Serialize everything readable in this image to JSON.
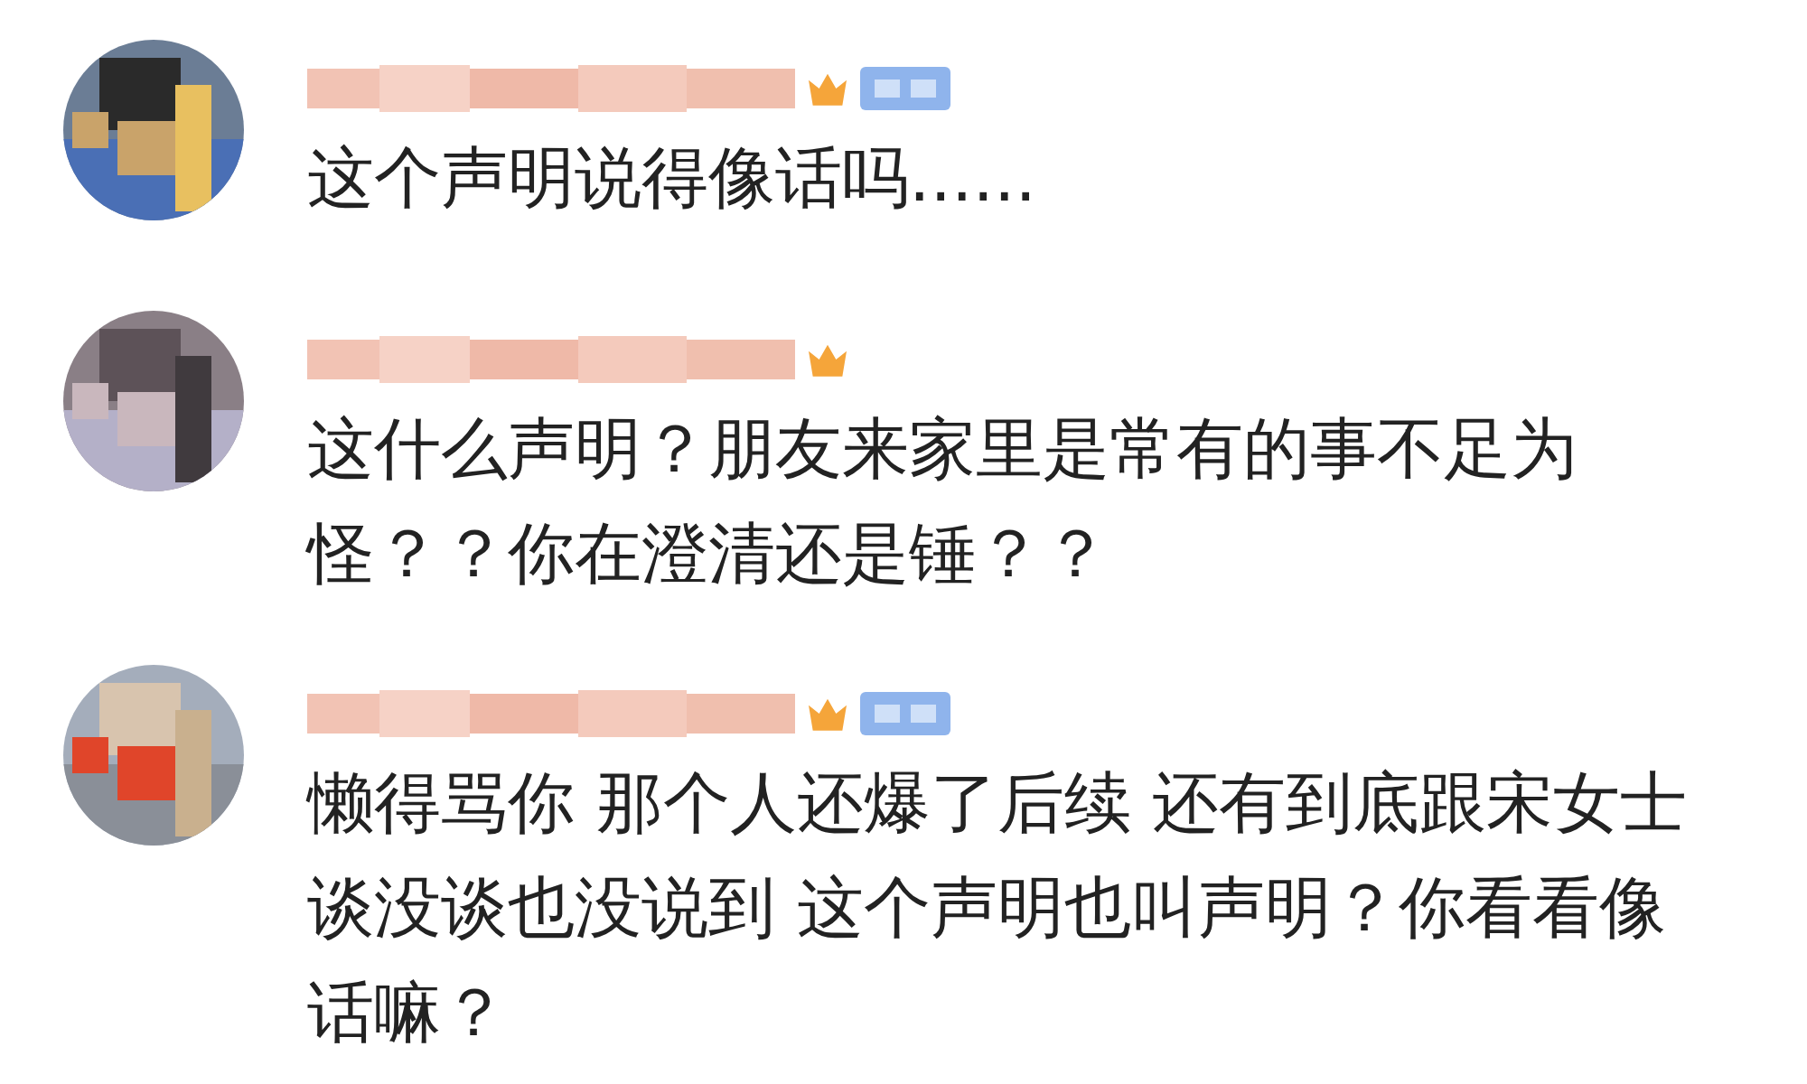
{
  "comments": [
    {
      "member_badge": true,
      "text": "这个声明说得像话吗......"
    },
    {
      "member_badge": false,
      "text": "这什么声明？朋友来家里是常有的事不足为怪？？你在澄清还是锤？？"
    },
    {
      "member_badge": true,
      "text": "懒得骂你 那个人还爆了后续 还有到底跟宋女士谈没谈也没说到 这个声明也叫声明？你看看像话嘛？"
    }
  ]
}
